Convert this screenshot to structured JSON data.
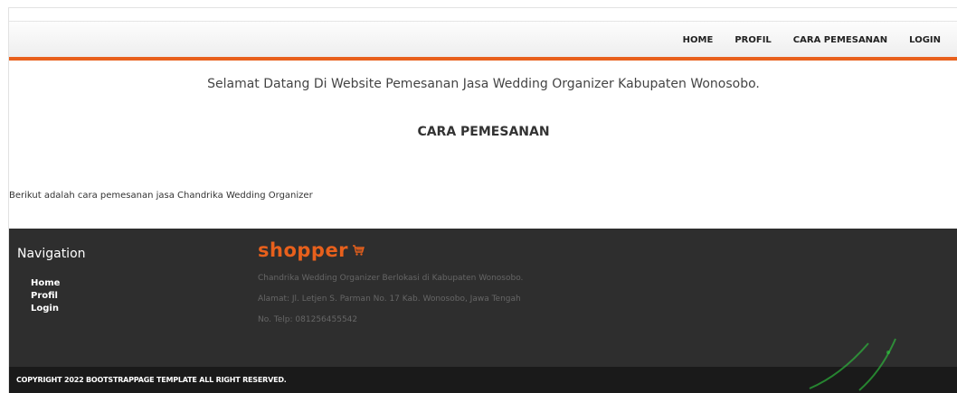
{
  "nav": {
    "items": [
      {
        "label": "HOME"
      },
      {
        "label": "PROFIL"
      },
      {
        "label": "CARA PEMESANAN"
      },
      {
        "label": "LOGIN"
      }
    ]
  },
  "main": {
    "welcome": "Selamat Datang Di Website Pemesanan Jasa Wedding Organizer Kabupaten Wonosobo.",
    "heading": "CARA PEMESANAN",
    "intro": "Berikut adalah cara pemesanan jasa Chandrika Wedding Organizer"
  },
  "footer": {
    "nav_title": "Navigation",
    "links": [
      {
        "label": "Home"
      },
      {
        "label": "Profil"
      },
      {
        "label": "Login"
      }
    ],
    "brand": "shopper",
    "info": [
      "Chandrika Wedding Organizer Berlokasi di Kabupaten Wonosobo.",
      "Alamat: Jl. Letjen S. Parman No. 17 Kab. Wonosobo, Jawa Tengah",
      "No. Telp: 081256455542"
    ],
    "copyright": "COPYRIGHT 2022 BOOTSTRAPPAGE TEMPLATE ALL RIGHT RESERVED."
  },
  "colors": {
    "accent": "#e8601c",
    "footer_bg": "#2e2e2e",
    "copyright_bg": "#1a1a1a"
  },
  "icons": {
    "brand_icon": "shopping-cart-icon"
  }
}
